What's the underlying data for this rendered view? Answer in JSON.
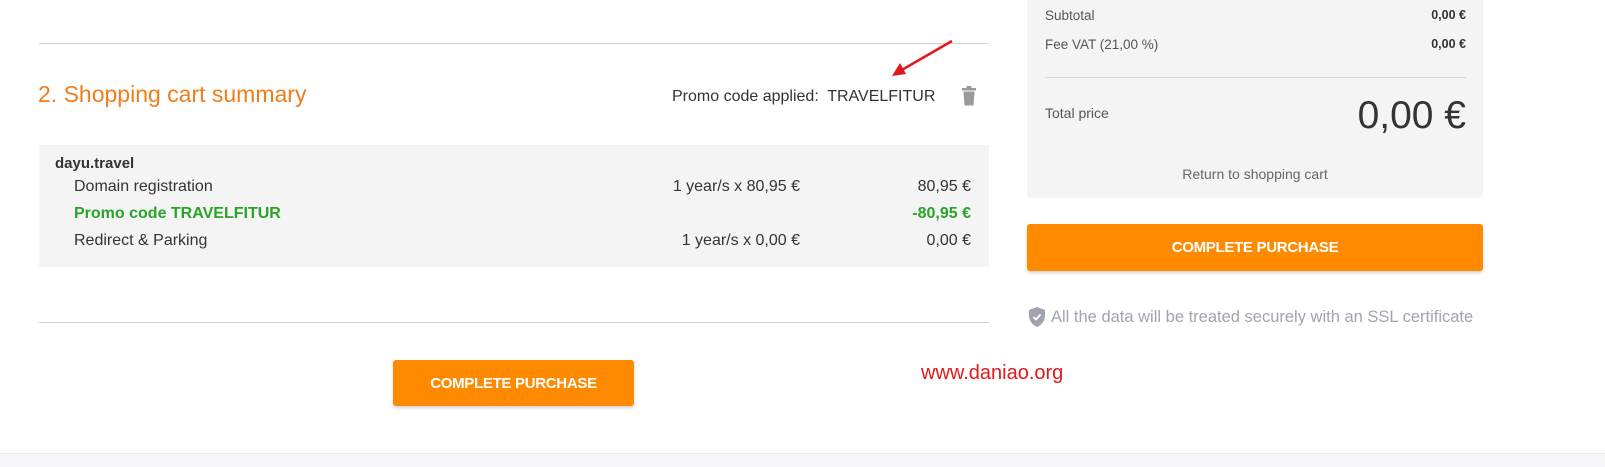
{
  "section": {
    "title": "2. Shopping cart summary",
    "promo_label": "Promo code applied:",
    "promo_code": "TRAVELFITUR",
    "icons": {
      "delete": "trash-icon",
      "arrow": "red-arrow"
    }
  },
  "cart": {
    "domain": "dayu.travel",
    "lines": [
      {
        "description": "Domain registration",
        "quantity": "1 year/s x 80,95 €",
        "amount": "80,95 €"
      },
      {
        "description": "Promo code TRAVELFITUR",
        "quantity": "",
        "amount": "-80,95 €"
      },
      {
        "description": "Redirect & Parking",
        "quantity": "1 year/s x 0,00 €",
        "amount": "0,00 €"
      }
    ]
  },
  "buttons": {
    "complete_purchase": "COMPLETE PURCHASE",
    "complete_purchase_side": "COMPLETE PURCHASE"
  },
  "summary": {
    "subtotal_label": "Subtotal",
    "subtotal_value": "0,00 €",
    "vat_label": "Fee VAT (21,00 %)",
    "vat_value": "0,00 €",
    "total_label": "Total price",
    "total_value": "0,00 €",
    "return_link": "Return to shopping cart"
  },
  "ssl_note": "All the data will be treated securely with an SSL certificate",
  "watermark": "www.daniao.org",
  "colors": {
    "accent_orange": "#ff8a00",
    "title_orange": "#f07d1a",
    "promo_green": "#29a329",
    "watermark_red": "#e31818"
  }
}
